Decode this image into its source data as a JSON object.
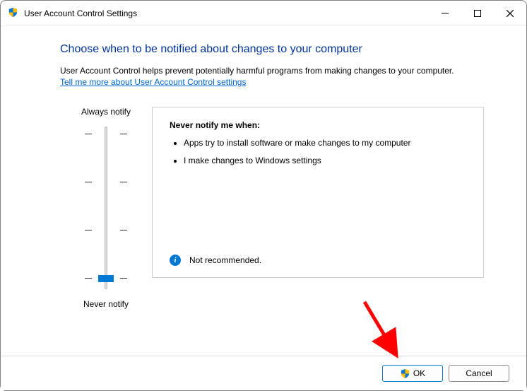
{
  "window": {
    "title": "User Account Control Settings"
  },
  "heading": "Choose when to be notified about changes to your computer",
  "description": "User Account Control helps prevent potentially harmful programs from making changes to your computer.",
  "link_text": "Tell me more about User Account Control settings",
  "slider": {
    "top_label": "Always notify",
    "bottom_label": "Never notify",
    "position": 3,
    "steps": 4
  },
  "info": {
    "title": "Never notify me when:",
    "bullets": [
      "Apps try to install software or make changes to my computer",
      "I make changes to Windows settings"
    ],
    "recommendation": "Not recommended."
  },
  "buttons": {
    "ok": "OK",
    "cancel": "Cancel"
  }
}
